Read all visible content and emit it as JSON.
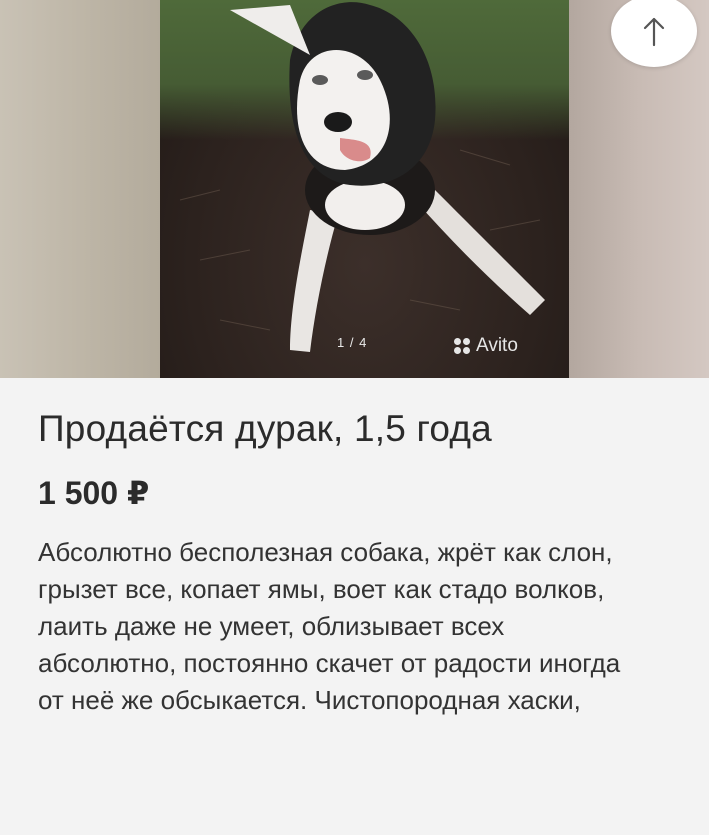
{
  "gallery": {
    "counter": "1 / 4",
    "watermark": "Avito",
    "scroll_top_icon": "arrow-up-icon"
  },
  "listing": {
    "title": "Продаётся дурак, 1,5 года",
    "price": "1 500 ₽",
    "description": "Абсолютно бесполезная собака, жрёт как слон, грызет все, копает ямы, воет как стадо волков, лаить даже не умеет, облизывает всех абсолютно, постоянно скачет от радости иногда от неё же обсыкается. Чистопородная хаски,"
  }
}
